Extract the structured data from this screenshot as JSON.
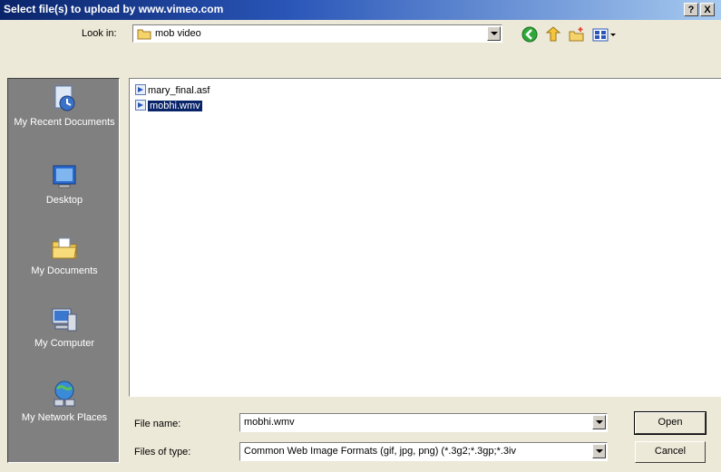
{
  "dialog": {
    "title": "Select file(s) to upload by www.vimeo.com",
    "help_label": "?",
    "close_label": "X"
  },
  "look_in": {
    "label": "Look in:",
    "value": "mob video"
  },
  "places": [
    {
      "label": "My Recent Documents",
      "icon": "recent-documents-icon"
    },
    {
      "label": "Desktop",
      "icon": "desktop-icon"
    },
    {
      "label": "My Documents",
      "icon": "my-documents-icon"
    },
    {
      "label": "My Computer",
      "icon": "my-computer-icon"
    },
    {
      "label": "My Network Places",
      "icon": "network-places-icon"
    }
  ],
  "files": [
    {
      "name": "mary_final.asf",
      "selected": false
    },
    {
      "name": "mobhi.wmv",
      "selected": true
    }
  ],
  "file_name": {
    "label": "File name:",
    "value": "mobhi.wmv"
  },
  "file_type": {
    "label": "Files of type:",
    "value": "Common Web Image Formats (gif, jpg, png) (*.3g2;*.3gp;*.3iv"
  },
  "buttons": {
    "open": "Open",
    "cancel": "Cancel"
  },
  "colors": {
    "title_bar": "#0a246a",
    "places_bar": "#808080",
    "selection": "#0a246a",
    "dialog_bg": "#ece9d8"
  }
}
